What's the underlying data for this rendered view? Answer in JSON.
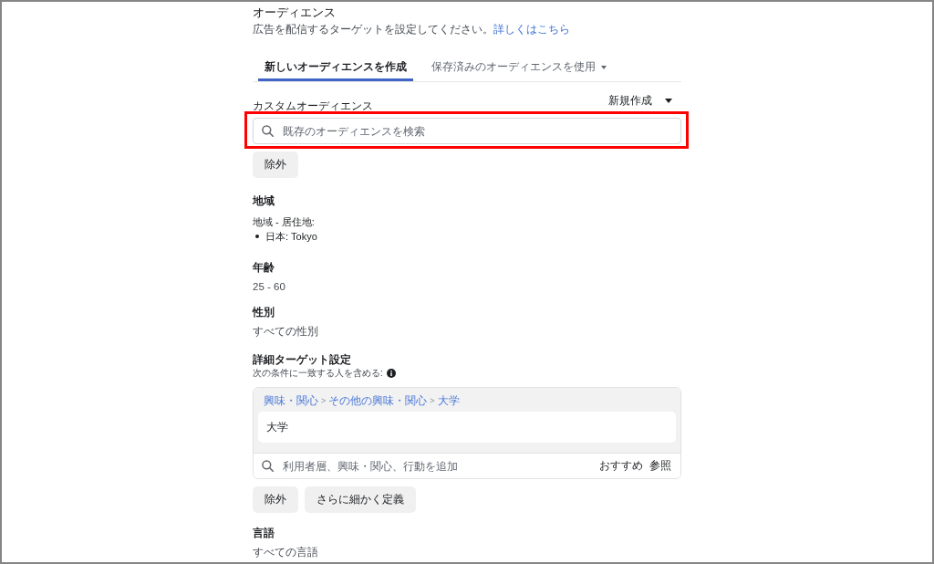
{
  "audience": {
    "title": "オーディエンス",
    "description": "広告を配信するターゲットを設定してください。",
    "help_link": "詳しくはこちら"
  },
  "tabs": [
    {
      "label": "新しいオーディエンスを作成",
      "selected": true,
      "dropdown": false
    },
    {
      "label": "保存済みのオーディエンスを使用",
      "selected": false,
      "dropdown": true
    }
  ],
  "custom_audience": {
    "title": "カスタムオーディエンス",
    "create_menu": "新規作成",
    "search": {
      "placeholder": "既存のオーディエンスを検索",
      "highlighted": true
    },
    "buttons": [
      "除外"
    ]
  },
  "location": {
    "title": "地域",
    "label": "地域 - 居住地:",
    "items": [
      "日本: Tokyo"
    ]
  },
  "age": {
    "title": "年齢",
    "value": "25 - 60"
  },
  "gender": {
    "title": "性別",
    "value": "すべての性別"
  },
  "detailed_targeting": {
    "title": "詳細ターゲット設定",
    "note": "次の条件に一致する人を含める:",
    "groups": [
      {
        "path": [
          "興味・関心",
          "その他の興味・関心",
          "大学"
        ],
        "separator": ">",
        "selections": [
          "大学"
        ]
      }
    ],
    "search": {
      "placeholder": "利用者層、興味・関心、行動を追加",
      "actions": [
        "おすすめ",
        "参照"
      ]
    },
    "buttons": [
      "除外",
      "さらに細かく定義"
    ]
  },
  "language": {
    "title": "言語",
    "value": "すべての言語"
  }
}
